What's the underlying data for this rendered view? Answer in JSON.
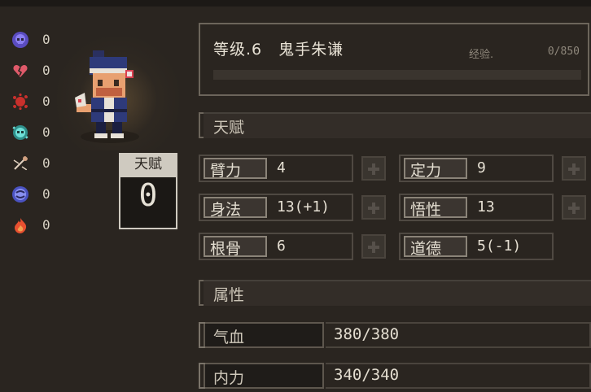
{
  "status_counters": [
    {
      "icon": "skull-icon",
      "color": "#7a6be0",
      "count": "0"
    },
    {
      "icon": "broken-heart-icon",
      "color": "#e05a6a",
      "count": "0"
    },
    {
      "icon": "blood-splat-icon",
      "color": "#c8302c",
      "count": "0"
    },
    {
      "icon": "poison-skull-icon",
      "color": "#4fc6c0",
      "count": "0"
    },
    {
      "icon": "needle-icon",
      "color": "#d0a080",
      "count": "0"
    },
    {
      "icon": "swirl-face-icon",
      "color": "#6a72e0",
      "count": "0"
    },
    {
      "icon": "fire-icon",
      "color": "#e85030",
      "count": "0"
    }
  ],
  "talent_box": {
    "label": "天赋",
    "value": "0"
  },
  "header": {
    "title": "等级.6　鬼手朱谦",
    "exp_label": "经验.",
    "exp_value": "0/850",
    "exp_progress": 0
  },
  "sections": {
    "talent": "天赋",
    "attributes": "属性"
  },
  "stats": [
    {
      "name": "臂力",
      "value": "4"
    },
    {
      "name": "定力",
      "value": "9"
    },
    {
      "name": "身法",
      "value": "13(+1)"
    },
    {
      "name": "悟性",
      "value": "13"
    },
    {
      "name": "根骨",
      "value": "6"
    },
    {
      "name": "道德",
      "value": "5(-1)"
    }
  ],
  "attributes": [
    {
      "name": "气血",
      "value": "380/380"
    },
    {
      "name": "内力",
      "value": "340/340"
    }
  ],
  "colors": {
    "background": "#2a2520",
    "text": "#d8d2c4",
    "panel_border": "#6c655b"
  }
}
